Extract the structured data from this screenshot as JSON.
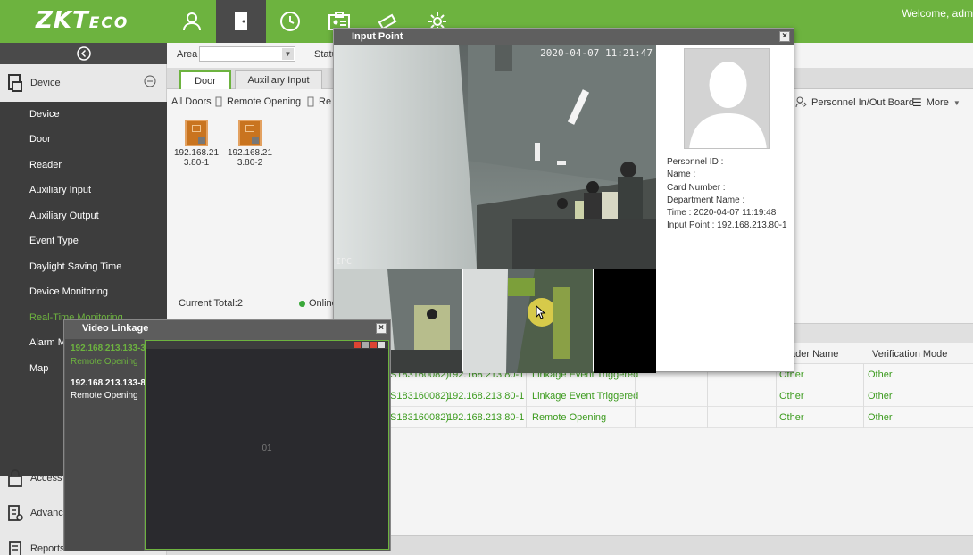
{
  "header": {
    "logo_main": "ZKT",
    "logo_small": "ECO",
    "welcome": "Welcome, adm",
    "nav_icons": [
      "person-icon",
      "door-icon",
      "clock-icon",
      "id-card-icon",
      "camera-icon",
      "gear-icon"
    ]
  },
  "sidebar": {
    "group_device": "Device",
    "items": [
      {
        "label": "Device"
      },
      {
        "label": "Door"
      },
      {
        "label": "Reader"
      },
      {
        "label": "Auxiliary Input"
      },
      {
        "label": "Auxiliary Output"
      },
      {
        "label": "Event Type"
      },
      {
        "label": "Daylight Saving Time"
      },
      {
        "label": "Device Monitoring"
      },
      {
        "label": "Real-Time Monitoring"
      },
      {
        "label": "Alarm M"
      },
      {
        "label": "Map"
      }
    ],
    "group_access": "Access",
    "group_advanced": "Advanc",
    "group_reports": "Reports"
  },
  "filters": {
    "area_label": "Area",
    "status_label": "Statu"
  },
  "tabs": [
    {
      "label": "Door"
    },
    {
      "label": "Auxiliary Input"
    }
  ],
  "toolbar": {
    "all_doors": "All Doors",
    "remote_opening": "Remote Opening",
    "re": "Re",
    "personnel_board": "Personnel In/Out Board",
    "more": "More"
  },
  "doors": [
    {
      "line1": "192.168.21",
      "line2": "3.80-1"
    },
    {
      "line1": "192.168.21",
      "line2": "3.80-2"
    }
  ],
  "summary": {
    "current_total": "Current Total:2",
    "online": "Online"
  },
  "events": {
    "columns": [
      "ader Name",
      "Verification Mode"
    ],
    "rows": [
      {
        "device": "S183160082)",
        "point": "192.168.213.80-1",
        "event": "Linkage Event Triggered",
        "reader": "Other",
        "verify": "Other"
      },
      {
        "device": "S183160082)",
        "point": "192.168.213.80-1",
        "event": "Linkage Event Triggered",
        "reader": "Other",
        "verify": "Other"
      },
      {
        "device": "S183160082)",
        "point": "192.168.213.80-1",
        "event": "Remote Opening",
        "reader": "Other",
        "verify": "Other"
      }
    ]
  },
  "input_point": {
    "title": "Input Point",
    "timestamp": "2020-04-07 11:21:47",
    "ipc": "IPC",
    "personnel_id": "Personnel ID :",
    "name": "Name :",
    "card_number": "Card Number :",
    "department_name": "Department Name :",
    "time": "Time : 2020-04-07 11:19:48",
    "input_point": "Input Point : 192.168.213.80-1"
  },
  "video_linkage": {
    "title": "Video Linkage",
    "items": [
      {
        "ip": "192.168.213.133-3",
        "event": "Remote Opening"
      },
      {
        "ip": "192.168.213.133-8",
        "event": "Remote Opening"
      }
    ],
    "screen_label": "01"
  },
  "colors": {
    "brand_green": "#6db33f",
    "dark_panel": "#3d3d3d",
    "event_green": "#3c9b1e"
  }
}
